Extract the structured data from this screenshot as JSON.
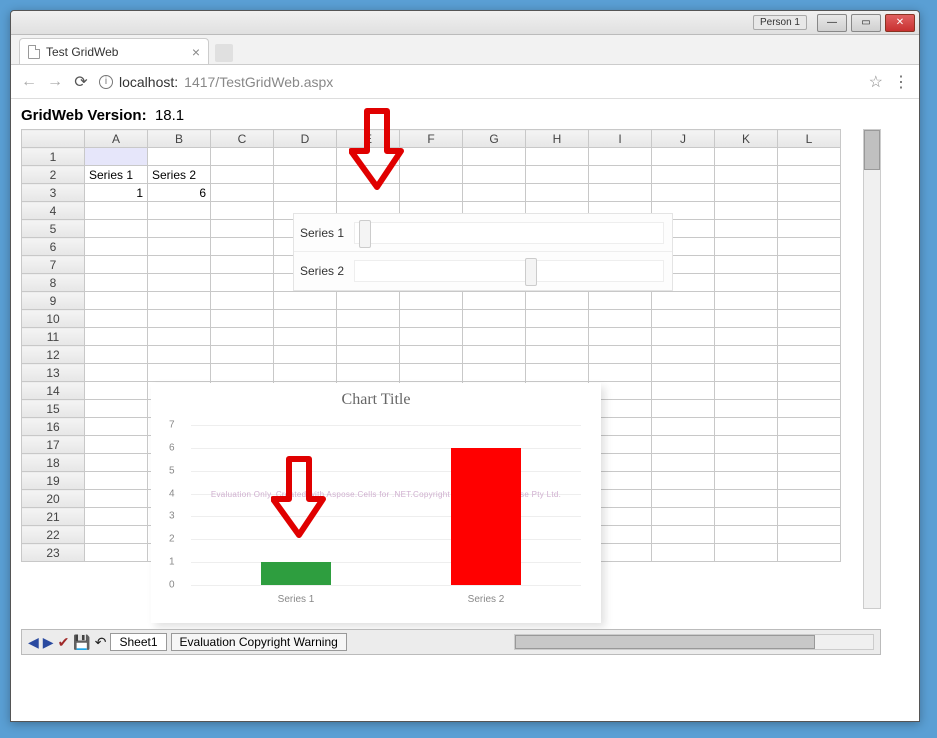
{
  "window": {
    "profile": "Person 1"
  },
  "browser": {
    "tab_title": "Test GridWeb",
    "url_host": "localhost:",
    "url_port_path": "1417/TestGridWeb.aspx"
  },
  "page": {
    "version_label": "GridWeb Version:",
    "version_value": "18.1"
  },
  "columns": [
    "A",
    "B",
    "C",
    "D",
    "E",
    "F",
    "G",
    "H",
    "I",
    "J",
    "K",
    "L"
  ],
  "rows": [
    "1",
    "2",
    "3",
    "4",
    "5",
    "6",
    "7",
    "8",
    "9",
    "10",
    "11",
    "12",
    "13",
    "14",
    "15",
    "16",
    "17",
    "18",
    "19",
    "20",
    "21",
    "22",
    "23"
  ],
  "cells": {
    "A2": "Series 1",
    "B2": "Series 2",
    "A3": "1",
    "B3": "6"
  },
  "mini_overlay": {
    "row1_label": "Series 1",
    "row2_label": "Series 2"
  },
  "bottom_bar": {
    "sheet_tab": "Sheet1",
    "warning_tab": "Evaluation Copyright Warning"
  },
  "chart_data": {
    "type": "bar",
    "title": "Chart Title",
    "categories": [
      "Series 1",
      "Series 2"
    ],
    "values": [
      1,
      6
    ],
    "colors": [
      "#2e9e3f",
      "#ff0000"
    ],
    "ylim": [
      0,
      7
    ],
    "yticks": [
      0,
      1,
      2,
      3,
      4,
      5,
      6,
      7
    ],
    "watermark": "Evaluation Only. Created with Aspose.Cells for .NET.Copyright 2003 - 2018 Aspose Pty Ltd."
  }
}
